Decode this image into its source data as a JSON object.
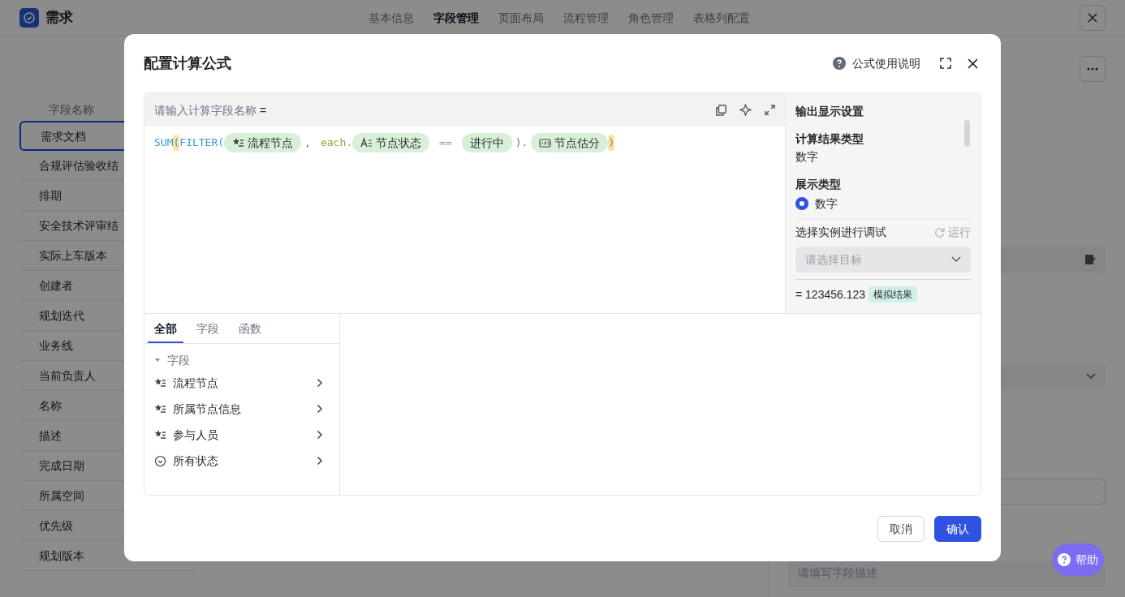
{
  "app": {
    "title": "需求"
  },
  "nav_tabs": [
    {
      "label": "基本信息",
      "selected": false
    },
    {
      "label": "字段管理",
      "selected": true
    },
    {
      "label": "页面布局",
      "selected": false
    },
    {
      "label": "流程管理",
      "selected": false
    },
    {
      "label": "角色管理",
      "selected": false
    },
    {
      "label": "表格列配置",
      "selected": false
    }
  ],
  "field_list": {
    "header": "字段名称",
    "items": [
      {
        "label": "需求文档",
        "selected": true
      },
      {
        "label": "合规评估验收结",
        "selected": false
      },
      {
        "label": "排期",
        "selected": false
      },
      {
        "label": "安全技术评审结",
        "selected": false
      },
      {
        "label": "实际上车版本",
        "selected": false
      },
      {
        "label": "创建者",
        "selected": false
      },
      {
        "label": "规划迭代",
        "selected": false
      },
      {
        "label": "业务线",
        "selected": false
      },
      {
        "label": "当前负责人",
        "selected": false
      },
      {
        "label": "名称",
        "selected": false
      },
      {
        "label": "描述",
        "selected": false
      },
      {
        "label": "完成日期",
        "selected": false
      },
      {
        "label": "所属空间",
        "selected": false
      },
      {
        "label": "优先级",
        "selected": false
      },
      {
        "label": "规划版本",
        "selected": false
      }
    ]
  },
  "detail_panel": {
    "description_placeholder": "请填写字段描述"
  },
  "help_button": "帮助",
  "dialog": {
    "title": "配置计算公式",
    "help_link": "公式使用说明",
    "editor": {
      "name_placeholder": "请输入计算字段名称",
      "equals": "=",
      "tokens": [
        {
          "kind": "func",
          "text": "SUM"
        },
        {
          "kind": "paren",
          "text": "("
        },
        {
          "kind": "func",
          "text": "FILTER("
        },
        {
          "kind": "multi_field",
          "text": "流程节点"
        },
        {
          "kind": "punct",
          "text": ","
        },
        {
          "kind": "keyword",
          "text": "each."
        },
        {
          "kind": "text_field",
          "text": "节点状态"
        },
        {
          "kind": "op",
          "text": "=="
        },
        {
          "kind": "value",
          "text": "进行中"
        },
        {
          "kind": "punct",
          "text": ")."
        },
        {
          "kind": "number_field",
          "text": "节点估分"
        },
        {
          "kind": "paren",
          "text": ")"
        }
      ]
    },
    "output": {
      "title": "输出显示设置",
      "result_type_label": "计算结果类型",
      "result_type": "数字",
      "display_type_label": "展示类型",
      "display_options": [
        {
          "label": "数字",
          "selected": true
        }
      ],
      "debug_label": "选择实例进行调试",
      "run_button": "运行",
      "run_disabled": true,
      "target_placeholder": "请选择目标",
      "result": "= 123456.123",
      "result_tag": "模拟结果"
    },
    "picker_tabs": [
      {
        "label": "全部",
        "selected": true
      },
      {
        "label": "字段",
        "selected": false
      },
      {
        "label": "函数",
        "selected": false
      }
    ],
    "picker_group": {
      "label": "字段",
      "expanded": true,
      "children": [
        {
          "label": "流程节点",
          "kind": "multi"
        },
        {
          "label": "所属节点信息",
          "kind": "multi"
        },
        {
          "label": "参与人员",
          "kind": "multi"
        },
        {
          "label": "所有状态",
          "kind": "status"
        }
      ]
    },
    "buttons": [
      {
        "label": "取消",
        "kind": "secondary"
      },
      {
        "label": "确认",
        "kind": "primary"
      }
    ]
  }
}
